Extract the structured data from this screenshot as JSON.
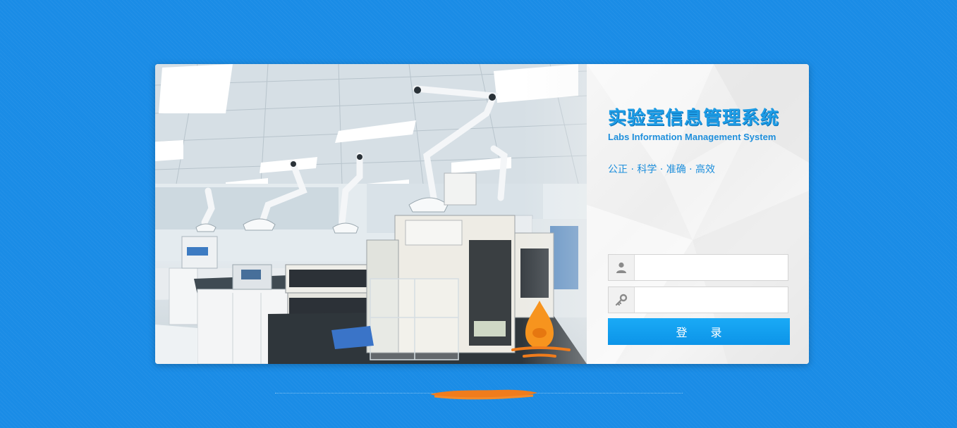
{
  "app": {
    "title_cn": "实验室信息管理系统",
    "title_en": "Labs Information Management System",
    "slogan": "公正 · 科学 · 准确 · 高效"
  },
  "login": {
    "username": {
      "value": "",
      "placeholder": "",
      "icon": "user-icon"
    },
    "password": {
      "value": "",
      "placeholder": "",
      "icon": "key-icon"
    },
    "submit_label": "登 录"
  },
  "colors": {
    "background": "#1a8ce6",
    "accent": "#1e9de6",
    "button": "#0c94e8",
    "redaction": "#f07c1c"
  }
}
